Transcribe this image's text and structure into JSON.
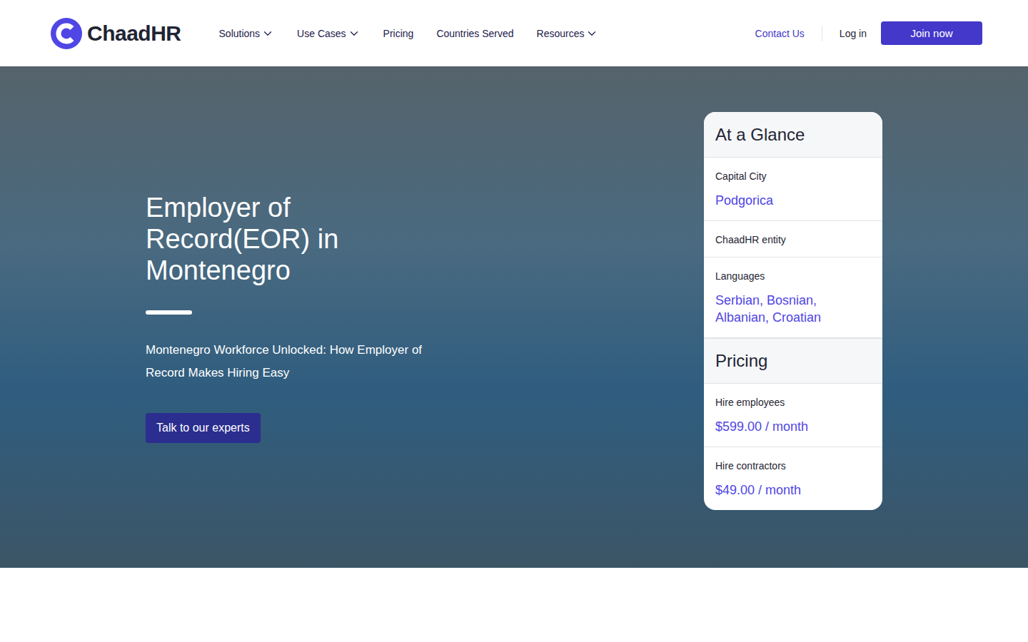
{
  "header": {
    "logo": "ChaadHR",
    "nav": [
      {
        "label": "Solutions",
        "dropdown": true
      },
      {
        "label": "Use Cases",
        "dropdown": true
      },
      {
        "label": "Pricing",
        "dropdown": false
      },
      {
        "label": "Countries Served",
        "dropdown": false
      },
      {
        "label": "Resources",
        "dropdown": true
      }
    ],
    "contact": "Contact Us",
    "login": "Log in",
    "join": "Join now"
  },
  "hero": {
    "title": "Employer of Record(EOR) in Montenegro",
    "subtitle": "Montenegro Workforce Unlocked: How Employer of Record Makes Hiring Easy",
    "cta": "Talk to our experts"
  },
  "glance": {
    "title": "At a Glance",
    "rows": [
      {
        "label": "Capital City",
        "value": "Podgorica"
      },
      {
        "label": "ChaadHR entity"
      },
      {
        "label": "Languages",
        "value": "Serbian, Bosnian, Albanian, Croatian"
      }
    ]
  },
  "pricing": {
    "title": "Pricing",
    "rows": [
      {
        "label": "Hire employees",
        "value": "$599.00 / month"
      },
      {
        "label": "Hire contractors",
        "value": "$49.00 / month"
      }
    ]
  }
}
